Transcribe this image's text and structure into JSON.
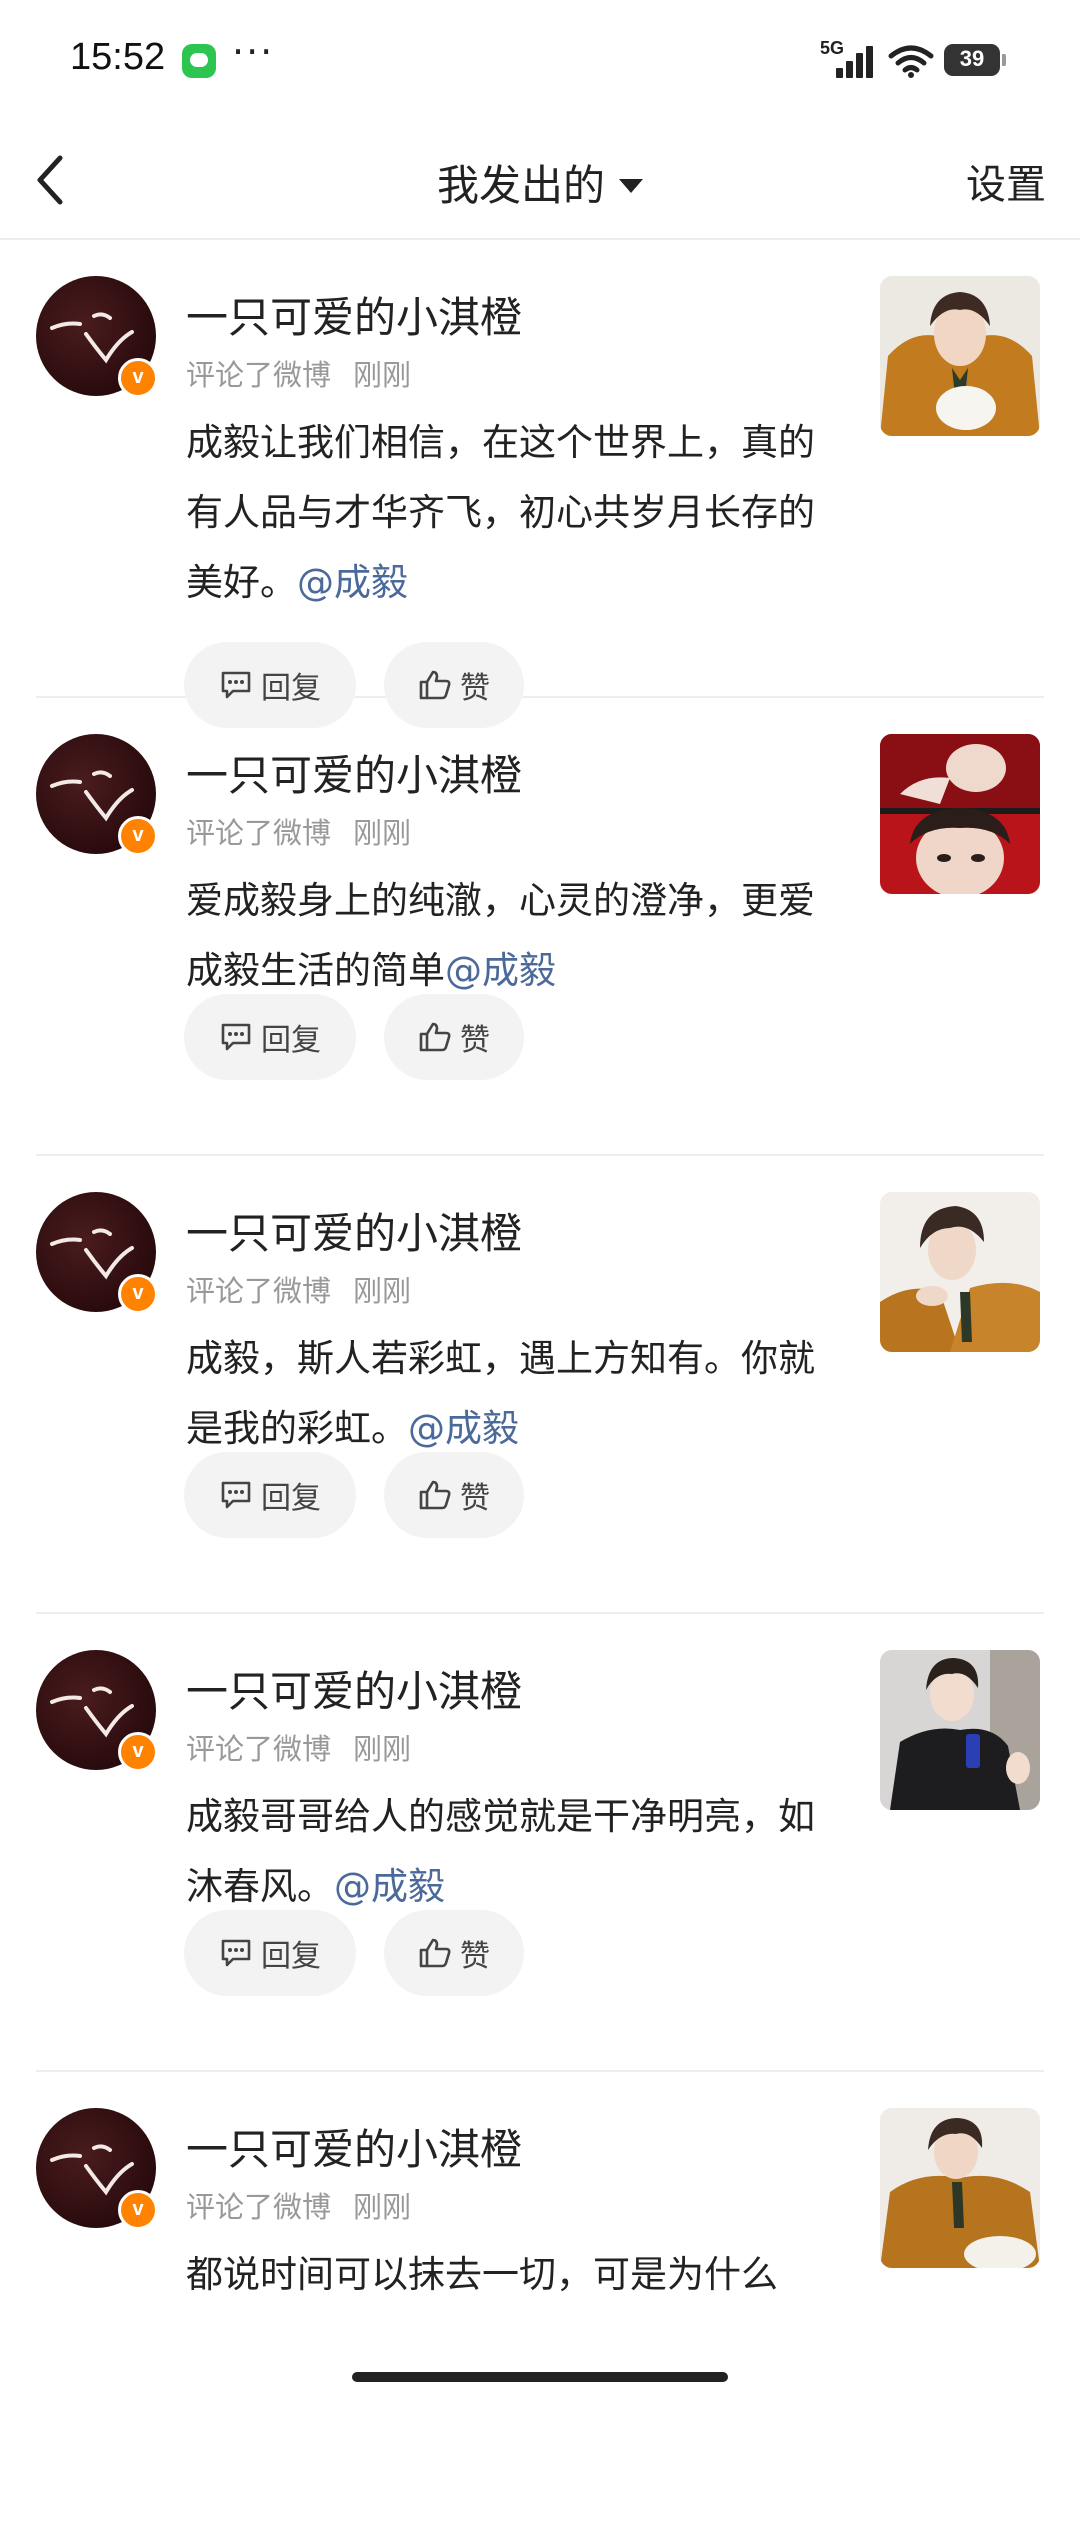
{
  "status_bar": {
    "time": "15:52",
    "dots": "···",
    "network": "5G",
    "battery": "39"
  },
  "nav": {
    "title": "我发出的",
    "settings": "设置"
  },
  "actions": {
    "reply": "回复",
    "like": "赞"
  },
  "cards": [
    {
      "username": "一只可爱的小淇橙",
      "action": "评论了微博",
      "time": "刚刚",
      "comment": "成毅让我们相信，在这个世界上，真的有人品与才华齐飞，初心共岁月长存的美好。",
      "mention": "@成毅"
    },
    {
      "username": "一只可爱的小淇橙",
      "action": "评论了微博",
      "time": "刚刚",
      "comment": "爱成毅身上的纯澈，心灵的澄净，更爱成毅生活的简单",
      "mention": "@成毅"
    },
    {
      "username": "一只可爱的小淇橙",
      "action": "评论了微博",
      "time": "刚刚",
      "comment": "成毅，斯人若彩虹，遇上方知有。你就是我的彩虹。",
      "mention": "@成毅"
    },
    {
      "username": "一只可爱的小淇橙",
      "action": "评论了微博",
      "time": "刚刚",
      "comment": "成毅哥哥给人的感觉就是干净明亮，如沐春风。",
      "mention": "@成毅"
    },
    {
      "username": "一只可爱的小淇橙",
      "action": "评论了微博",
      "time": "刚刚",
      "comment": "都说时间可以抹去一切，可是为什么",
      "mention": ""
    }
  ]
}
